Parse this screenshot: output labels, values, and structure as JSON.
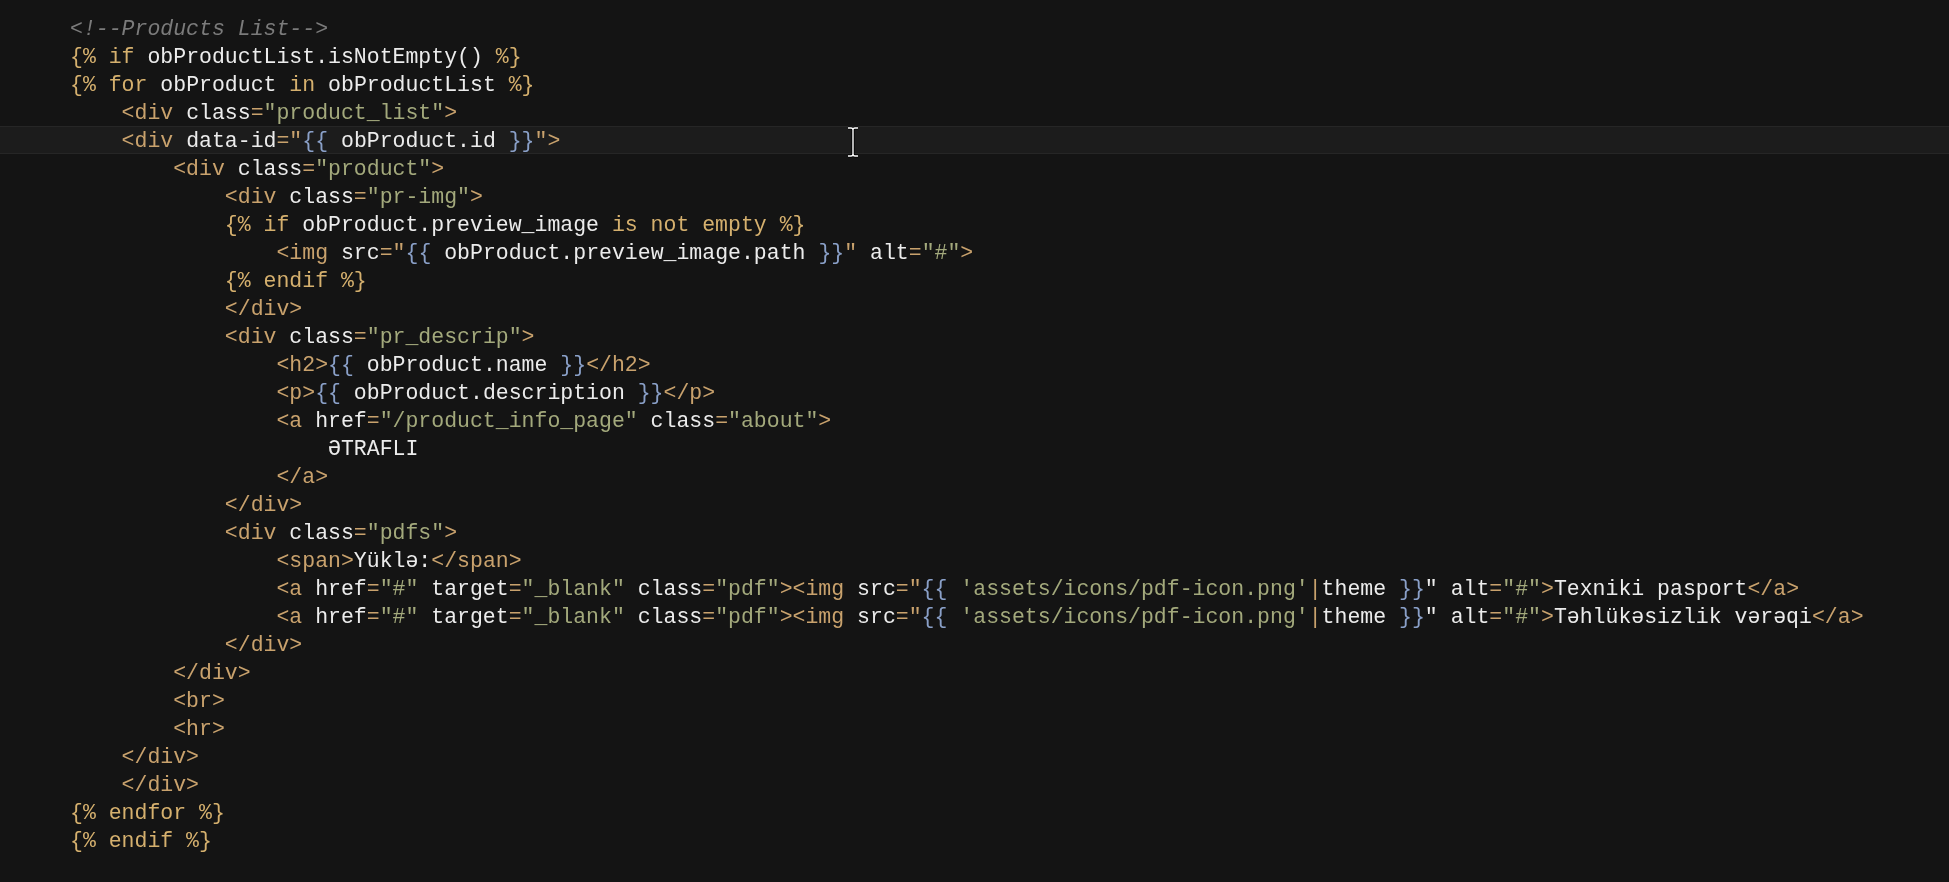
{
  "editor": {
    "lines": [
      {
        "current": false,
        "tokens": [
          {
            "kind": "comment",
            "text": "<!--Products List-->"
          }
        ]
      },
      {
        "current": false,
        "tokens": [
          {
            "kind": "keyword",
            "text": "{% if "
          },
          {
            "kind": "ident",
            "text": "obProductList.isNotEmpty() "
          },
          {
            "kind": "keyword",
            "text": "%}"
          }
        ]
      },
      {
        "current": false,
        "tokens": [
          {
            "kind": "keyword",
            "text": "{% for "
          },
          {
            "kind": "ident",
            "text": "obProduct "
          },
          {
            "kind": "keyword",
            "text": "in "
          },
          {
            "kind": "ident",
            "text": "obProductList "
          },
          {
            "kind": "keyword",
            "text": "%}"
          }
        ]
      },
      {
        "current": false,
        "tokens": [
          {
            "kind": "tag",
            "text": "    <div "
          },
          {
            "kind": "attr",
            "text": "class"
          },
          {
            "kind": "tag",
            "text": "="
          },
          {
            "kind": "string",
            "text": "\"product_list\""
          },
          {
            "kind": "tag",
            "text": ">"
          }
        ]
      },
      {
        "current": true,
        "tokens": [
          {
            "kind": "tag",
            "text": "    <div "
          },
          {
            "kind": "attr",
            "text": "data-id"
          },
          {
            "kind": "tag",
            "text": "=\""
          },
          {
            "kind": "brace",
            "text": "{{ "
          },
          {
            "kind": "ident",
            "text": "obProduct.id "
          },
          {
            "kind": "brace",
            "text": "}}"
          },
          {
            "kind": "tag",
            "text": "\">"
          }
        ]
      },
      {
        "current": false,
        "tokens": [
          {
            "kind": "tag",
            "text": "        <div "
          },
          {
            "kind": "attr",
            "text": "class"
          },
          {
            "kind": "tag",
            "text": "="
          },
          {
            "kind": "string",
            "text": "\"product\""
          },
          {
            "kind": "tag",
            "text": ">"
          }
        ]
      },
      {
        "current": false,
        "tokens": [
          {
            "kind": "tag",
            "text": "            <div "
          },
          {
            "kind": "attr",
            "text": "class"
          },
          {
            "kind": "tag",
            "text": "="
          },
          {
            "kind": "string",
            "text": "\"pr-img\""
          },
          {
            "kind": "tag",
            "text": ">"
          }
        ]
      },
      {
        "current": false,
        "tokens": [
          {
            "kind": "keyword",
            "text": "            {% if "
          },
          {
            "kind": "ident",
            "text": "obProduct.preview_image "
          },
          {
            "kind": "keyword",
            "text": "is not empty %}"
          }
        ]
      },
      {
        "current": false,
        "tokens": [
          {
            "kind": "tag",
            "text": "                <img "
          },
          {
            "kind": "attr",
            "text": "src"
          },
          {
            "kind": "tag",
            "text": "=\""
          },
          {
            "kind": "brace",
            "text": "{{ "
          },
          {
            "kind": "ident",
            "text": "obProduct.preview_image.path "
          },
          {
            "kind": "brace",
            "text": "}}"
          },
          {
            "kind": "tag",
            "text": "\" "
          },
          {
            "kind": "attr",
            "text": "alt"
          },
          {
            "kind": "tag",
            "text": "="
          },
          {
            "kind": "string",
            "text": "\"#\""
          },
          {
            "kind": "tag",
            "text": ">"
          }
        ]
      },
      {
        "current": false,
        "tokens": [
          {
            "kind": "keyword",
            "text": "            {% endif %}"
          }
        ]
      },
      {
        "current": false,
        "tokens": [
          {
            "kind": "tag",
            "text": "            </div>"
          }
        ]
      },
      {
        "current": false,
        "tokens": [
          {
            "kind": "tag",
            "text": "            <div "
          },
          {
            "kind": "attr",
            "text": "class"
          },
          {
            "kind": "tag",
            "text": "="
          },
          {
            "kind": "string",
            "text": "\"pr_descrip\""
          },
          {
            "kind": "tag",
            "text": ">"
          }
        ]
      },
      {
        "current": false,
        "tokens": [
          {
            "kind": "tag",
            "text": "                <h2>"
          },
          {
            "kind": "brace",
            "text": "{{ "
          },
          {
            "kind": "ident",
            "text": "obProduct.name "
          },
          {
            "kind": "brace",
            "text": "}}"
          },
          {
            "kind": "tag",
            "text": "</h2>"
          }
        ]
      },
      {
        "current": false,
        "tokens": [
          {
            "kind": "tag",
            "text": "                <p>"
          },
          {
            "kind": "brace",
            "text": "{{ "
          },
          {
            "kind": "ident",
            "text": "obProduct.description "
          },
          {
            "kind": "brace",
            "text": "}}"
          },
          {
            "kind": "tag",
            "text": "</p>"
          }
        ]
      },
      {
        "current": false,
        "tokens": [
          {
            "kind": "tag",
            "text": "                <a "
          },
          {
            "kind": "attr",
            "text": "href"
          },
          {
            "kind": "tag",
            "text": "="
          },
          {
            "kind": "string",
            "text": "\"/product_info_page\" "
          },
          {
            "kind": "attr",
            "text": "class"
          },
          {
            "kind": "tag",
            "text": "="
          },
          {
            "kind": "string",
            "text": "\"about\""
          },
          {
            "kind": "tag",
            "text": ">"
          }
        ]
      },
      {
        "current": false,
        "tokens": [
          {
            "kind": "ident",
            "text": "                    ƏTRAFLI"
          }
        ]
      },
      {
        "current": false,
        "tokens": [
          {
            "kind": "tag",
            "text": "                </a>"
          }
        ]
      },
      {
        "current": false,
        "tokens": [
          {
            "kind": "tag",
            "text": "            </div>"
          }
        ]
      },
      {
        "current": false,
        "tokens": [
          {
            "kind": "tag",
            "text": "            <div "
          },
          {
            "kind": "attr",
            "text": "class"
          },
          {
            "kind": "tag",
            "text": "="
          },
          {
            "kind": "string",
            "text": "\"pdfs\""
          },
          {
            "kind": "tag",
            "text": ">"
          }
        ]
      },
      {
        "current": false,
        "tokens": [
          {
            "kind": "tag",
            "text": "                <span>"
          },
          {
            "kind": "ident",
            "text": "Yüklə:"
          },
          {
            "kind": "tag",
            "text": "</span>"
          }
        ]
      },
      {
        "current": false,
        "tokens": [
          {
            "kind": "tag",
            "text": "                <a "
          },
          {
            "kind": "attr",
            "text": "href"
          },
          {
            "kind": "tag",
            "text": "="
          },
          {
            "kind": "string",
            "text": "\"#\" "
          },
          {
            "kind": "attr",
            "text": "target"
          },
          {
            "kind": "tag",
            "text": "="
          },
          {
            "kind": "string",
            "text": "\"_blank\" "
          },
          {
            "kind": "attr",
            "text": "class"
          },
          {
            "kind": "tag",
            "text": "="
          },
          {
            "kind": "string",
            "text": "\"pdf\""
          },
          {
            "kind": "tag",
            "text": "><img "
          },
          {
            "kind": "attr",
            "text": "src"
          },
          {
            "kind": "tag",
            "text": "=\""
          },
          {
            "kind": "brace",
            "text": "{{ "
          },
          {
            "kind": "string",
            "text": "'assets/icons/pdf-icon.png'"
          },
          {
            "kind": "tag",
            "text": "|"
          },
          {
            "kind": "ident",
            "text": "theme "
          },
          {
            "kind": "brace",
            "text": "}}"
          },
          {
            "kind": "ident",
            "text": "\" alt"
          },
          {
            "kind": "tag",
            "text": "="
          },
          {
            "kind": "string",
            "text": "\"#\""
          },
          {
            "kind": "tag",
            "text": ">"
          },
          {
            "kind": "ident",
            "text": "Texniki pasport"
          },
          {
            "kind": "tag",
            "text": "</a>"
          }
        ]
      },
      {
        "current": false,
        "tokens": [
          {
            "kind": "tag",
            "text": "                <a "
          },
          {
            "kind": "attr",
            "text": "href"
          },
          {
            "kind": "tag",
            "text": "="
          },
          {
            "kind": "string",
            "text": "\"#\" "
          },
          {
            "kind": "attr",
            "text": "target"
          },
          {
            "kind": "tag",
            "text": "="
          },
          {
            "kind": "string",
            "text": "\"_blank\" "
          },
          {
            "kind": "attr",
            "text": "class"
          },
          {
            "kind": "tag",
            "text": "="
          },
          {
            "kind": "string",
            "text": "\"pdf\""
          },
          {
            "kind": "tag",
            "text": "><img "
          },
          {
            "kind": "attr",
            "text": "src"
          },
          {
            "kind": "tag",
            "text": "=\""
          },
          {
            "kind": "brace",
            "text": "{{ "
          },
          {
            "kind": "string",
            "text": "'assets/icons/pdf-icon.png'"
          },
          {
            "kind": "tag",
            "text": "|"
          },
          {
            "kind": "ident",
            "text": "theme "
          },
          {
            "kind": "brace",
            "text": "}}"
          },
          {
            "kind": "ident",
            "text": "\" alt"
          },
          {
            "kind": "tag",
            "text": "="
          },
          {
            "kind": "string",
            "text": "\"#\""
          },
          {
            "kind": "tag",
            "text": ">"
          },
          {
            "kind": "ident",
            "text": "Təhlükəsizlik vərəqi"
          },
          {
            "kind": "tag",
            "text": "</a>"
          }
        ]
      },
      {
        "current": false,
        "tokens": [
          {
            "kind": "tag",
            "text": "            </div>"
          }
        ]
      },
      {
        "current": false,
        "tokens": [
          {
            "kind": "tag",
            "text": "        </div>"
          }
        ]
      },
      {
        "current": false,
        "tokens": [
          {
            "kind": "tag",
            "text": "        <br>"
          }
        ]
      },
      {
        "current": false,
        "tokens": [
          {
            "kind": "tag",
            "text": "        <hr>"
          }
        ]
      },
      {
        "current": false,
        "tokens": [
          {
            "kind": "tag",
            "text": "    </div>"
          }
        ]
      },
      {
        "current": false,
        "tokens": [
          {
            "kind": "tag",
            "text": "    </div>"
          }
        ]
      },
      {
        "current": false,
        "tokens": [
          {
            "kind": "keyword",
            "text": "{% endfor %}"
          }
        ]
      },
      {
        "current": false,
        "tokens": [
          {
            "kind": "keyword",
            "text": "{% endif %}"
          }
        ]
      }
    ]
  }
}
